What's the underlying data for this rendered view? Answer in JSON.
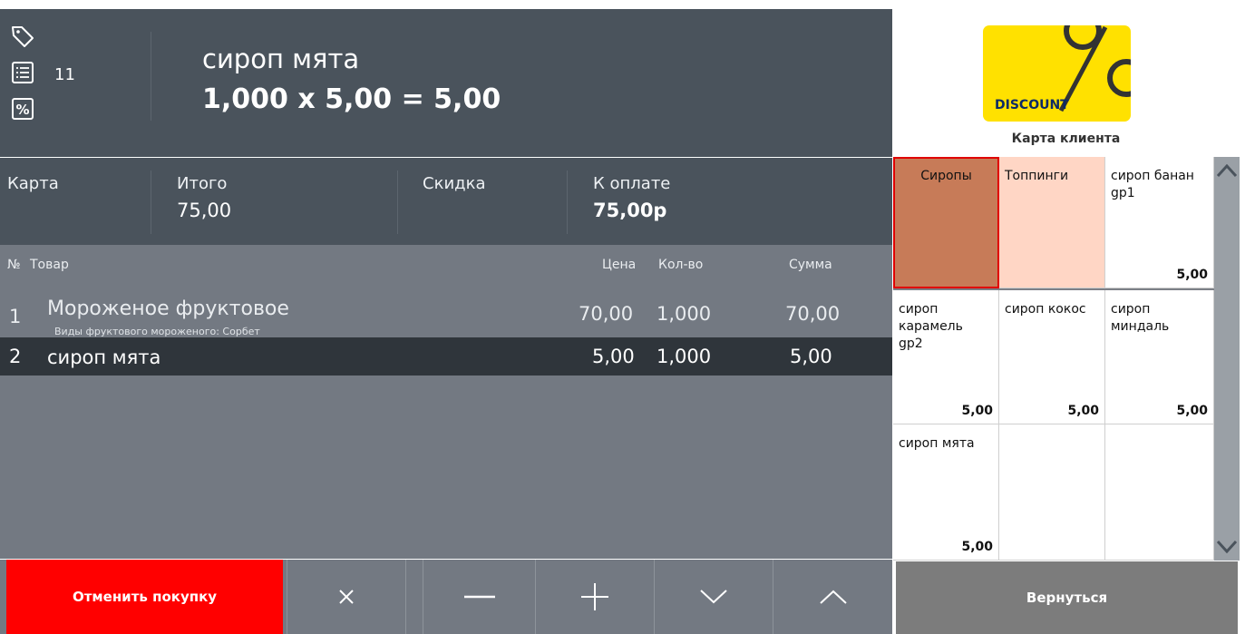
{
  "header": {
    "order_number": "11",
    "last_item_name": "сироп мята",
    "last_item_formula": "1,000 x 5,00 = 5,00"
  },
  "totals": {
    "card_label": "Карта",
    "total_label": "Итого",
    "total_value": "75,00",
    "discount_label": "Скидка",
    "discount_value": "",
    "to_pay_label": "К оплате",
    "to_pay_value": "75,00р"
  },
  "table": {
    "columns": {
      "no": "№",
      "item": "Товар",
      "price": "Цена",
      "qty": "Кол-во",
      "sum": "Сумма"
    },
    "rows": [
      {
        "no": "1",
        "name": "Мороженое фруктовое",
        "modifier": "Виды фруктового мороженого: Сорбет",
        "price": "70,00",
        "qty": "1,000",
        "sum": "70,00"
      },
      {
        "no": "2",
        "name": "сироп мята",
        "modifier": "",
        "price": "5,00",
        "qty": "1,000",
        "sum": "5,00"
      }
    ]
  },
  "actions": {
    "cancel_label": "Отменить покупку",
    "delete_icon": "close-icon",
    "minus_icon": "minus-icon",
    "plus_icon": "plus-icon",
    "down_icon": "chevron-down-icon",
    "up_icon": "chevron-up-icon"
  },
  "client_card": {
    "badge_text": "DISCOUNT",
    "label": "Карта клиента"
  },
  "catalog": {
    "tiles": [
      {
        "name": "Сиропы",
        "price": "",
        "kind": "group",
        "selected": true,
        "color": "#c77b58"
      },
      {
        "name": "Топпинги",
        "price": "",
        "kind": "group",
        "selected": false,
        "color": "#ffd6c5"
      },
      {
        "name": "сироп банан gp1",
        "price": "5,00",
        "kind": "product"
      },
      {
        "name": "сироп карамель gp2",
        "price": "5,00",
        "kind": "product"
      },
      {
        "name": "сироп кокос",
        "price": "5,00",
        "kind": "product"
      },
      {
        "name": "сироп миндаль",
        "price": "5,00",
        "kind": "product"
      },
      {
        "name": "сироп мята",
        "price": "5,00",
        "kind": "product"
      },
      {
        "name": "",
        "price": "",
        "kind": "empty"
      },
      {
        "name": "",
        "price": "",
        "kind": "empty"
      }
    ]
  },
  "back_label": "Вернуться",
  "colors": {
    "header_bg": "#4a535c",
    "table_bg": "#737982",
    "selected_row_bg": "#2f353b",
    "cancel_bg": "#ff0000",
    "discount_yellow": "#ffe100",
    "back_bg": "#7c7c7c"
  }
}
